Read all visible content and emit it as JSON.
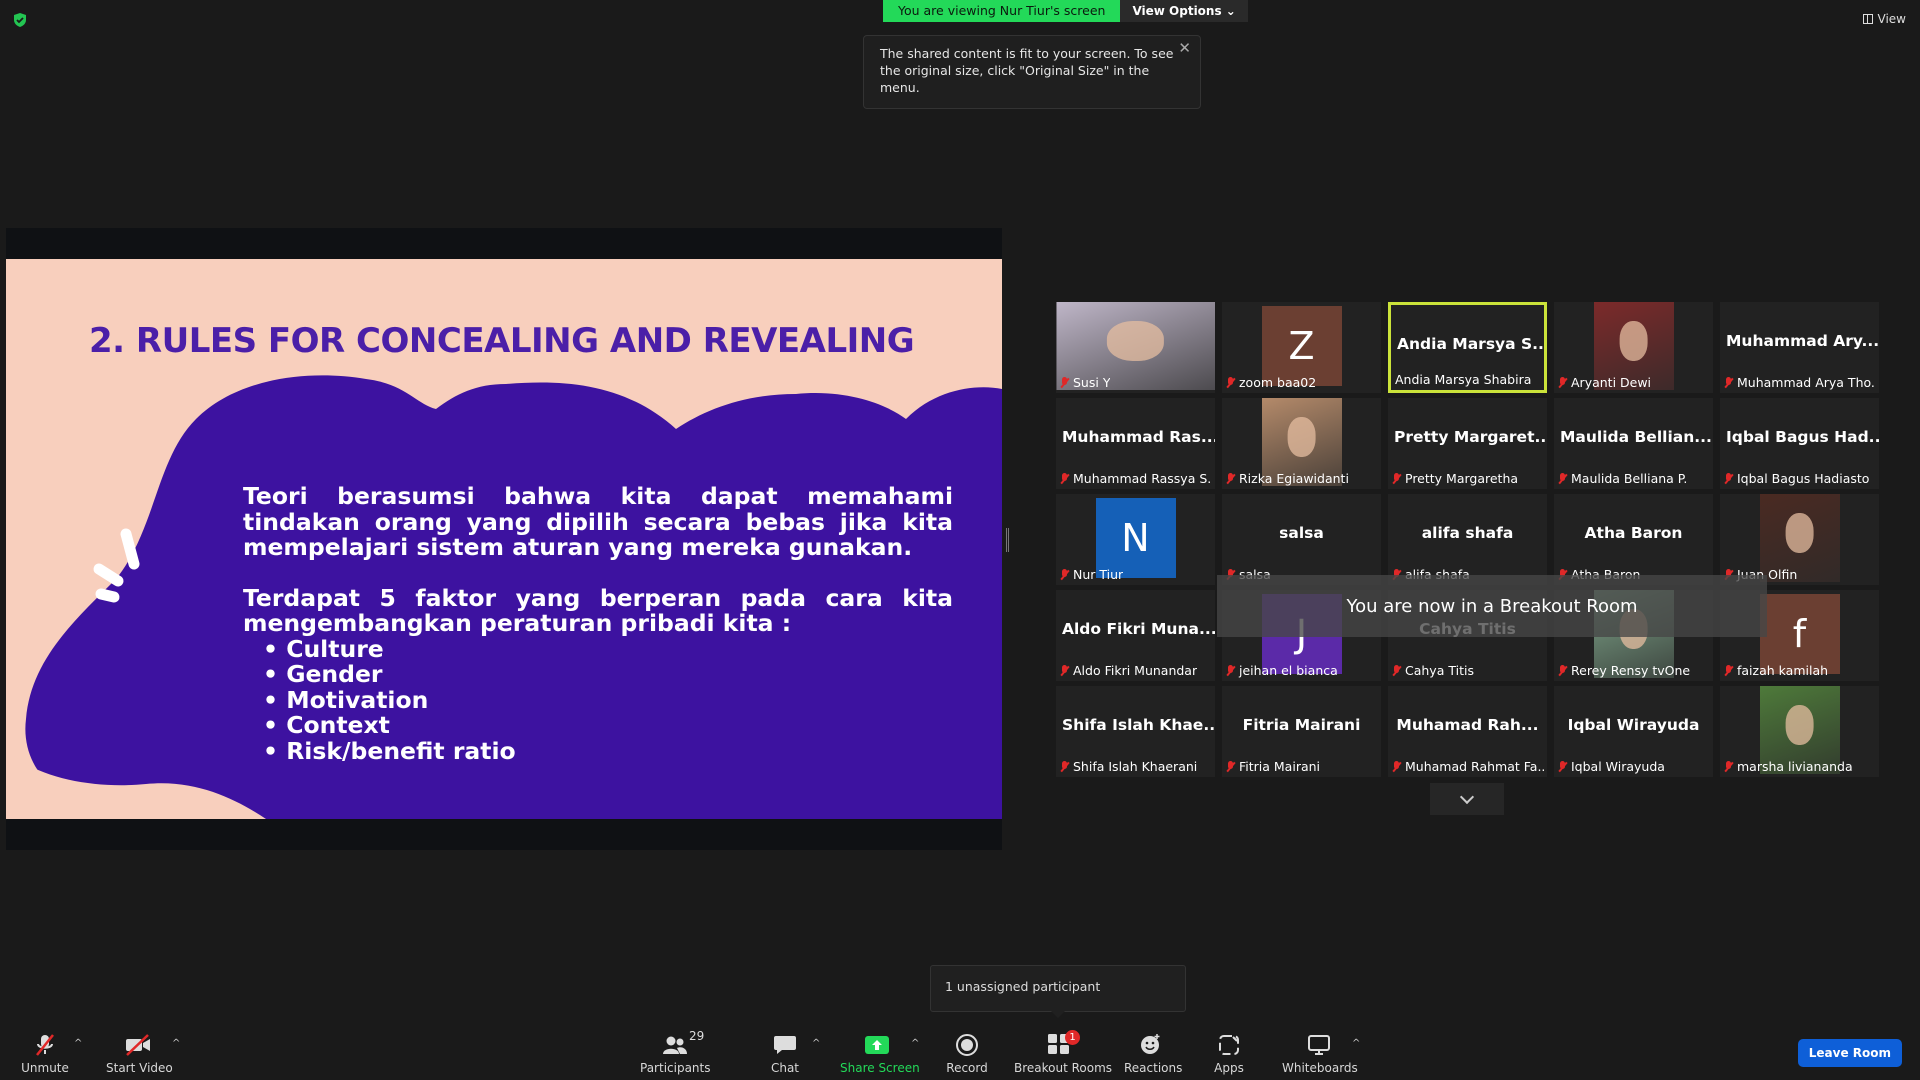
{
  "banner": {
    "viewing": "You are viewing Nur Tiur's screen",
    "view_options": "View Options ⌄"
  },
  "tooltip": {
    "text": "The shared content is fit to your screen. To see the original size, click \"Original Size\" in the menu."
  },
  "view_button": "View",
  "slide": {
    "title": "2. RULES FOR CONCEALING AND REVEALING",
    "para1": "Teori berasumsi bahwa kita dapat memahami tindakan orang yang dipilih secara bebas jika kita mempelajari sistem aturan yang mereka gunakan.",
    "para2": "Terdapat 5 faktor yang berperan pada cara kita mengembangkan peraturan pribadi kita :",
    "bullets": [
      "Culture",
      "Gender",
      "Motivation",
      "Context",
      "Risk/benefit ratio"
    ]
  },
  "tiles": [
    {
      "big": "",
      "name": "Susi Y",
      "kind": "photo",
      "color": "#bfb6c8"
    },
    {
      "big": "",
      "name": "zoom baa02",
      "kind": "letter",
      "letter": "Z",
      "color": "#6b3f32"
    },
    {
      "big": "Andia Marsya S...",
      "name": "Andia Marsya Shabira",
      "kind": "text",
      "active": true
    },
    {
      "big": "",
      "name": "Aryanti Dewi",
      "kind": "photo",
      "color": "#7c2a2a"
    },
    {
      "big": "Muhammad Ary...",
      "name": "Muhammad Arya Tho...",
      "kind": "text"
    },
    {
      "big": "Muhammad Ras...",
      "name": "Muhammad Rassya S...",
      "kind": "text"
    },
    {
      "big": "",
      "name": "Rizka Egiawidanti",
      "kind": "photo",
      "color": "#b48a6a"
    },
    {
      "big": "Pretty Margaret...",
      "name": "Pretty Margaretha",
      "kind": "text"
    },
    {
      "big": "Maulida Bellian...",
      "name": "Maulida Belliana P.",
      "kind": "text"
    },
    {
      "big": "Iqbal Bagus Had...",
      "name": "Iqbal Bagus Hadiasto",
      "kind": "text"
    },
    {
      "big": "",
      "name": "Nur Tiur",
      "kind": "letter",
      "letter": "N",
      "color": "#1560b7"
    },
    {
      "big": "salsa",
      "name": "salsa",
      "kind": "text"
    },
    {
      "big": "alifa shafa",
      "name": "alifa shafa",
      "kind": "text"
    },
    {
      "big": "Atha Baron",
      "name": "Atha Baron",
      "kind": "text"
    },
    {
      "big": "",
      "name": "Juan Olfin",
      "kind": "photo",
      "color": "#4a2a22"
    },
    {
      "big": "Aldo Fikri Muna...",
      "name": "Aldo Fikri Munandar",
      "kind": "text"
    },
    {
      "big": "",
      "name": "jeihan el bianca",
      "kind": "letter",
      "letter": "J",
      "color": "#5b2aa8"
    },
    {
      "big": "Cahya Titis",
      "name": "Cahya Titis",
      "kind": "text"
    },
    {
      "big": "",
      "name": "Rerey Rensy tvOne",
      "kind": "photo",
      "color": "#7fa58a"
    },
    {
      "big": "",
      "name": "faizah kamilah",
      "kind": "letter",
      "letter": "f",
      "color": "#6b3f32"
    },
    {
      "big": "Shifa Islah Khae...",
      "name": "Shifa Islah Khaerani",
      "kind": "text"
    },
    {
      "big": "Fitria Mairani",
      "name": "Fitria Mairani",
      "kind": "text"
    },
    {
      "big": "Muhamad Rah...",
      "name": "Muhamad Rahmat Fa...",
      "kind": "text"
    },
    {
      "big": "Iqbal Wirayuda",
      "name": "Iqbal Wirayuda",
      "kind": "text"
    },
    {
      "big": "",
      "name": "marsha livianandа",
      "kind": "photo",
      "color": "#4e7a3a"
    }
  ],
  "breakout_notice": "You are now in a Breakout Room",
  "unassigned": "1 unassigned participant",
  "toolbar": {
    "unmute": "Unmute",
    "start_video": "Start Video",
    "participants": "Participants",
    "participants_count": "29",
    "chat": "Chat",
    "share_screen": "Share Screen",
    "record": "Record",
    "breakout_rooms": "Breakout Rooms",
    "breakout_badge": "1",
    "reactions": "Reactions",
    "apps": "Apps",
    "whiteboards": "Whiteboards",
    "leave_room": "Leave Room"
  },
  "colors": {
    "share_green": "#23d959",
    "slide_bg": "#f8cfbd",
    "slide_purple": "#3d12a0",
    "title_purple": "#4b1fa8",
    "active_border": "#cbe33a",
    "leave_blue": "#0e5fd8"
  }
}
